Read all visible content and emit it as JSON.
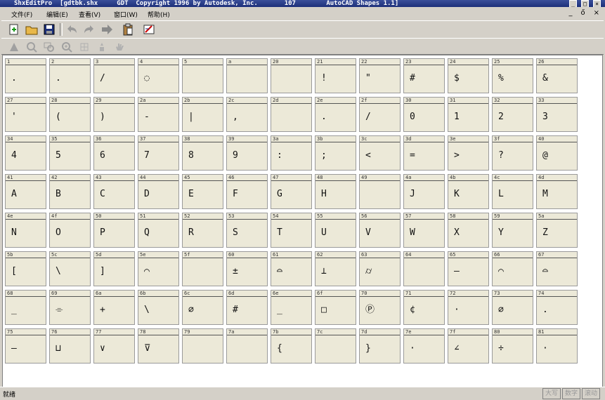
{
  "window": {
    "title": "ShxEditPro  [gdtbk.shx     GDT  Copyright 1996 by Autodesk, Inc.       107        AutoCAD Shapes 1.1]",
    "controls": [
      "_",
      "□",
      "×"
    ]
  },
  "menu": {
    "items": [
      "文件(F)",
      "编辑(E)",
      "查看(V)",
      "窗口(W)",
      "帮助(H)"
    ],
    "mdi_controls": [
      "_",
      "ő",
      "×"
    ]
  },
  "toolbar1": {
    "buttons": [
      "new-icon",
      "open-icon",
      "save-icon",
      "undo-icon",
      "redo-icon",
      "forward-icon",
      "paste-icon",
      "edit-icon"
    ]
  },
  "toolbar2": {
    "buttons": [
      "arrow-icon",
      "zoom-icon",
      "zoom-window-icon",
      "zoom-all-icon",
      "grid-icon",
      "pan-icon",
      "hand-icon"
    ]
  },
  "cells": [
    {
      "num": "1",
      "glyph": "."
    },
    {
      "num": "2",
      "glyph": "."
    },
    {
      "num": "3",
      "glyph": "/"
    },
    {
      "num": "4",
      "glyph": "◌"
    },
    {
      "num": "5",
      "glyph": ""
    },
    {
      "num": "a",
      "glyph": ""
    },
    {
      "num": "20",
      "glyph": ""
    },
    {
      "num": "21",
      "glyph": "!"
    },
    {
      "num": "22",
      "glyph": "\""
    },
    {
      "num": "23",
      "glyph": "#"
    },
    {
      "num": "24",
      "glyph": "$"
    },
    {
      "num": "25",
      "glyph": "%"
    },
    {
      "num": "26",
      "glyph": "&"
    },
    {
      "num": "27",
      "glyph": "'"
    },
    {
      "num": "28",
      "glyph": "("
    },
    {
      "num": "29",
      "glyph": ")"
    },
    {
      "num": "2a",
      "glyph": "-"
    },
    {
      "num": "2b",
      "glyph": "|"
    },
    {
      "num": "2c",
      "glyph": ","
    },
    {
      "num": "2d",
      "glyph": ""
    },
    {
      "num": "2e",
      "glyph": "."
    },
    {
      "num": "2f",
      "glyph": "/"
    },
    {
      "num": "30",
      "glyph": "0"
    },
    {
      "num": "31",
      "glyph": "1"
    },
    {
      "num": "32",
      "glyph": "2"
    },
    {
      "num": "33",
      "glyph": "3"
    },
    {
      "num": "34",
      "glyph": "4"
    },
    {
      "num": "35",
      "glyph": "5"
    },
    {
      "num": "36",
      "glyph": "6"
    },
    {
      "num": "37",
      "glyph": "7"
    },
    {
      "num": "38",
      "glyph": "8"
    },
    {
      "num": "39",
      "glyph": "9"
    },
    {
      "num": "3a",
      "glyph": ":"
    },
    {
      "num": "3b",
      "glyph": ";"
    },
    {
      "num": "3c",
      "glyph": "<"
    },
    {
      "num": "3d",
      "glyph": "="
    },
    {
      "num": "3e",
      "glyph": ">"
    },
    {
      "num": "3f",
      "glyph": "?"
    },
    {
      "num": "40",
      "glyph": "@"
    },
    {
      "num": "41",
      "glyph": "A"
    },
    {
      "num": "42",
      "glyph": "B"
    },
    {
      "num": "43",
      "glyph": "C"
    },
    {
      "num": "44",
      "glyph": "D"
    },
    {
      "num": "45",
      "glyph": "E"
    },
    {
      "num": "46",
      "glyph": "F"
    },
    {
      "num": "47",
      "glyph": "G"
    },
    {
      "num": "48",
      "glyph": "H"
    },
    {
      "num": "49",
      "glyph": ""
    },
    {
      "num": "4a",
      "glyph": "J"
    },
    {
      "num": "4b",
      "glyph": "K"
    },
    {
      "num": "4c",
      "glyph": "L"
    },
    {
      "num": "4d",
      "glyph": "M"
    },
    {
      "num": "4e",
      "glyph": "N"
    },
    {
      "num": "4f",
      "glyph": "O"
    },
    {
      "num": "50",
      "glyph": "P"
    },
    {
      "num": "51",
      "glyph": "Q"
    },
    {
      "num": "52",
      "glyph": "R"
    },
    {
      "num": "53",
      "glyph": "S"
    },
    {
      "num": "54",
      "glyph": "T"
    },
    {
      "num": "55",
      "glyph": "U"
    },
    {
      "num": "56",
      "glyph": "V"
    },
    {
      "num": "57",
      "glyph": "W"
    },
    {
      "num": "58",
      "glyph": "X"
    },
    {
      "num": "59",
      "glyph": "Y"
    },
    {
      "num": "5a",
      "glyph": "Z"
    },
    {
      "num": "5b",
      "glyph": "["
    },
    {
      "num": "5c",
      "glyph": "\\"
    },
    {
      "num": "5d",
      "glyph": "]"
    },
    {
      "num": "5e",
      "glyph": "⌒"
    },
    {
      "num": "5f",
      "glyph": ""
    },
    {
      "num": "60",
      "glyph": "±"
    },
    {
      "num": "61",
      "glyph": "⌓"
    },
    {
      "num": "62",
      "glyph": "⊥"
    },
    {
      "num": "63",
      "glyph": "⌭"
    },
    {
      "num": "64",
      "glyph": ""
    },
    {
      "num": "65",
      "glyph": "—"
    },
    {
      "num": "66",
      "glyph": "⌒"
    },
    {
      "num": "67",
      "glyph": "⌓"
    },
    {
      "num": "68",
      "glyph": "_"
    },
    {
      "num": "69",
      "glyph": "⌯"
    },
    {
      "num": "6a",
      "glyph": "+"
    },
    {
      "num": "6b",
      "glyph": "\\"
    },
    {
      "num": "6c",
      "glyph": "⌀"
    },
    {
      "num": "6d",
      "glyph": "#"
    },
    {
      "num": "6e",
      "glyph": "_"
    },
    {
      "num": "6f",
      "glyph": "□"
    },
    {
      "num": "70",
      "glyph": "Ⓟ"
    },
    {
      "num": "71",
      "glyph": "¢"
    },
    {
      "num": "72",
      "glyph": "·"
    },
    {
      "num": "73",
      "glyph": "⌀"
    },
    {
      "num": "74",
      "glyph": "."
    },
    {
      "num": "75",
      "glyph": "—"
    },
    {
      "num": "76",
      "glyph": "⊔"
    },
    {
      "num": "77",
      "glyph": "∨"
    },
    {
      "num": "78",
      "glyph": "⊽"
    },
    {
      "num": "79",
      "glyph": ""
    },
    {
      "num": "7a",
      "glyph": ""
    },
    {
      "num": "7b",
      "glyph": "{"
    },
    {
      "num": "7c",
      "glyph": ""
    },
    {
      "num": "7d",
      "glyph": "}"
    },
    {
      "num": "7e",
      "glyph": "·"
    },
    {
      "num": "7f",
      "glyph": "∠"
    },
    {
      "num": "80",
      "glyph": "÷"
    },
    {
      "num": "81",
      "glyph": "·"
    }
  ],
  "status": {
    "text": "就绪",
    "indicators": [
      "大写",
      "数字",
      "滚动"
    ]
  }
}
